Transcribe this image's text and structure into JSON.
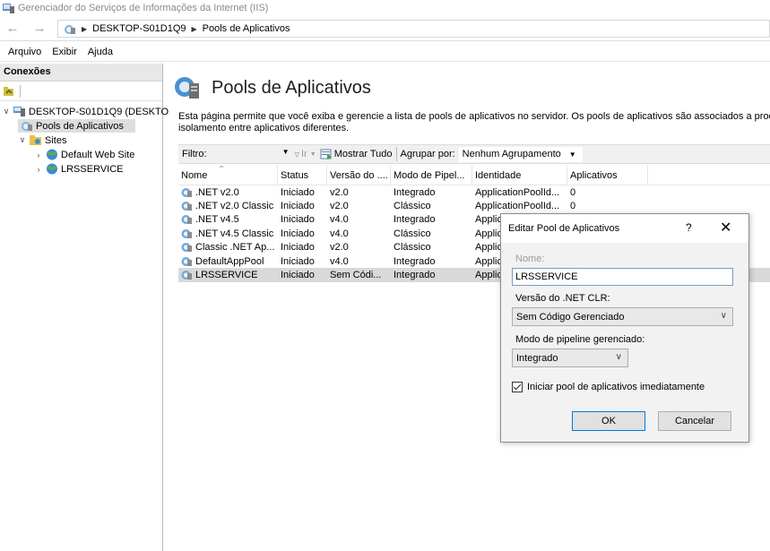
{
  "window": {
    "title": "Gerenciador do Serviços de Informações da Internet (IIS)"
  },
  "address": {
    "crumbs": [
      "DESKTOP-S01D1Q9",
      "Pools de Aplicativos"
    ]
  },
  "menu": {
    "items": [
      "Arquivo",
      "Exibir",
      "Ajuda"
    ]
  },
  "connections": {
    "header": "Conexões",
    "tree": [
      {
        "label": "DESKTOP-S01D1Q9 (DESKTOP",
        "level": 0,
        "expanded": true,
        "icon": "server-icon"
      },
      {
        "label": "Pools de Aplicativos",
        "level": 1,
        "selected": true,
        "icon": "app-pools-icon"
      },
      {
        "label": "Sites",
        "level": 1,
        "expanded": true,
        "icon": "sites-folder-icon"
      },
      {
        "label": "Default Web Site",
        "level": 2,
        "icon": "website-icon"
      },
      {
        "label": "LRSSERVICE",
        "level": 2,
        "icon": "website-icon"
      }
    ]
  },
  "main": {
    "title": "Pools de Aplicativos",
    "description_line1": "Esta página permite que você exiba e gerencie a lista de pools de aplicativos no servidor. Os pools de aplicativos são associados a processos",
    "description_line2": "isolamento entre aplicativos diferentes.",
    "filter_label": "Filtro:",
    "go_label": "Ir",
    "show_all_label": "Mostrar Tudo",
    "group_by_label": "Agrupar por:",
    "group_by_value": "Nenhum Agrupamento"
  },
  "table": {
    "columns": [
      "Nome",
      "Status",
      "Versão do ....",
      "Modo de Pipel...",
      "Identidade",
      "Aplicativos",
      ""
    ],
    "rows": [
      [
        ".NET v2.0",
        "Iniciado",
        "v2.0",
        "Integrado",
        "ApplicationPoolId...",
        "0"
      ],
      [
        ".NET v2.0 Classic",
        "Iniciado",
        "v2.0",
        "Clássico",
        "ApplicationPoolId...",
        "0"
      ],
      [
        ".NET v4.5",
        "Iniciado",
        "v4.0",
        "Integrado",
        "Applic",
        ""
      ],
      [
        ".NET v4.5 Classic",
        "Iniciado",
        "v4.0",
        "Clássico",
        "Applic",
        ""
      ],
      [
        "Classic .NET Ap...",
        "Iniciado",
        "v2.0",
        "Clássico",
        "Applic",
        ""
      ],
      [
        "DefaultAppPool",
        "Iniciado",
        "v4.0",
        "Integrado",
        "Applic",
        ""
      ],
      [
        "LRSSERVICE",
        "Iniciado",
        "Sem Códi...",
        "Integrado",
        "Applic",
        ""
      ]
    ],
    "selected_row": 6
  },
  "dialog": {
    "title": "Editar Pool de Aplicativos",
    "help": "?",
    "close": "✕",
    "name_label": "Nome:",
    "name_value": "LRSSERVICE",
    "clr_label": "Versão do .NET CLR:",
    "clr_value": "Sem Código Gerenciado",
    "pipeline_label": "Modo de pipeline gerenciado:",
    "pipeline_value": "Integrado",
    "start_checkbox_label": "Iniciar pool de aplicativos imediatamente",
    "start_checked": true,
    "ok_label": "OK",
    "cancel_label": "Cancelar"
  },
  "colors": {
    "accent": "#0078d7",
    "selection": "#d9d9d9"
  }
}
